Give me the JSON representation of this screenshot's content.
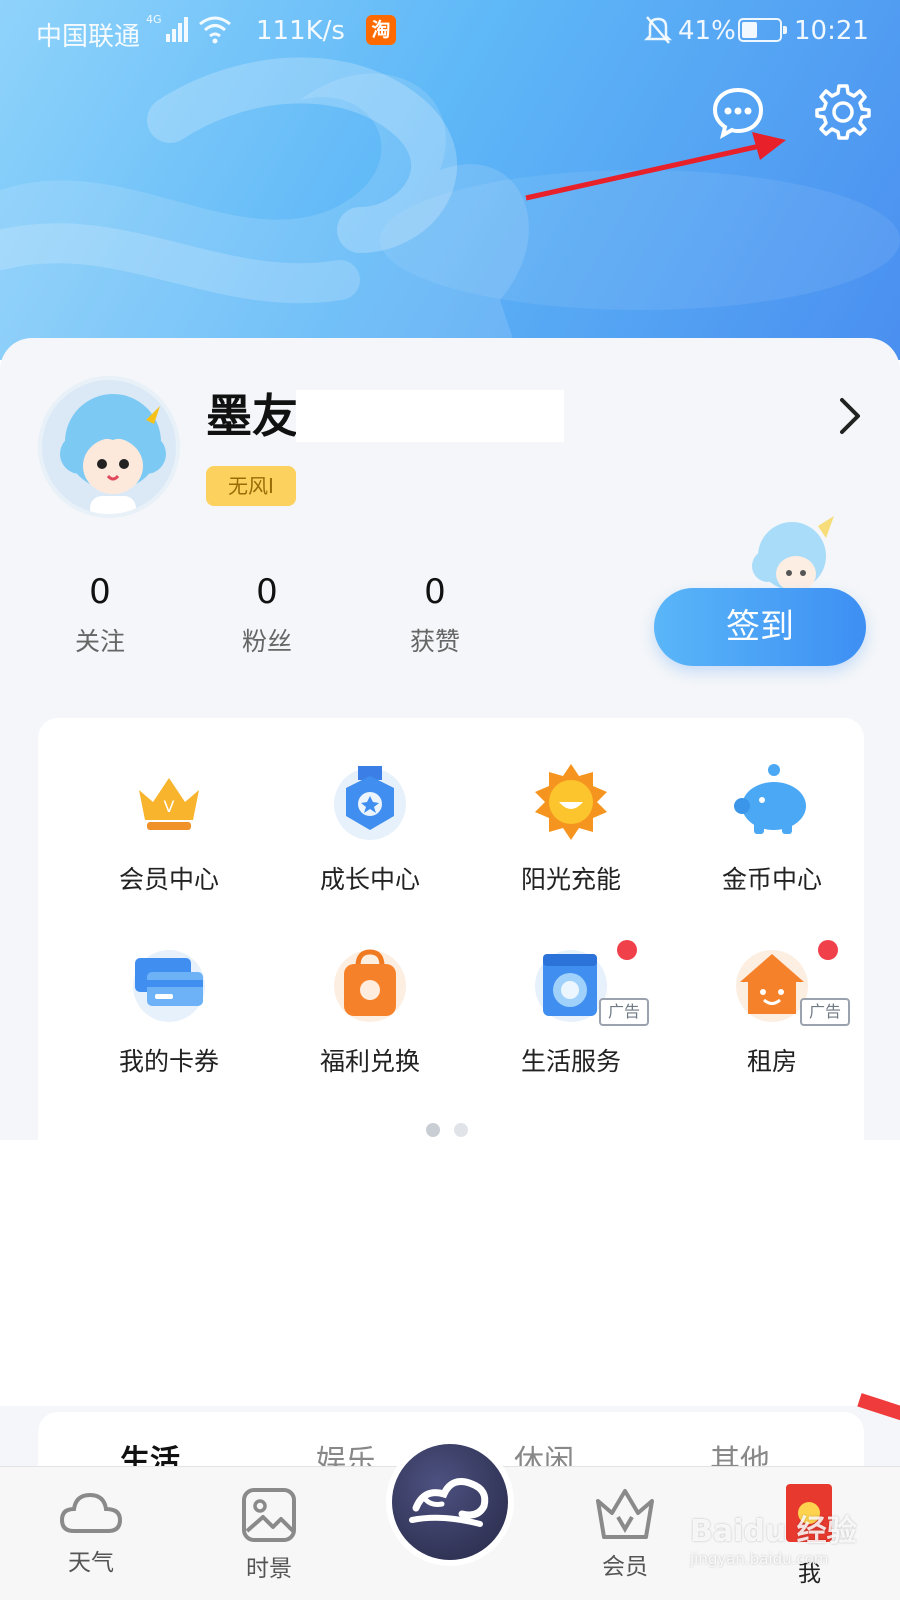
{
  "status_bar": {
    "carrier": "中国联通",
    "network": "4G",
    "speed": "111K/s",
    "taobao_icon": "淘",
    "battery": "41%",
    "battery_level": 0.41,
    "time": "10:21"
  },
  "header": {
    "icons": [
      "message-icon",
      "settings-gear-icon"
    ]
  },
  "profile": {
    "username": "墨友",
    "badge": "无风I",
    "stats": [
      {
        "value": "0",
        "label": "关注"
      },
      {
        "value": "0",
        "label": "粉丝"
      },
      {
        "value": "0",
        "label": "获赞"
      }
    ],
    "checkin_label": "签到"
  },
  "services": {
    "items": [
      {
        "label": "会员中心",
        "icon": "crown-icon"
      },
      {
        "label": "成长中心",
        "icon": "medal-icon"
      },
      {
        "label": "阳光充能",
        "icon": "sun-icon"
      },
      {
        "label": "金币中心",
        "icon": "piggy-bank-icon"
      },
      {
        "label": "我的卡券",
        "icon": "card-icon"
      },
      {
        "label": "福利兑换",
        "icon": "shopping-bag-icon"
      },
      {
        "label": "生活服务",
        "icon": "washing-machine-icon",
        "ad": "广告"
      },
      {
        "label": "租房",
        "icon": "house-icon",
        "ad": "广告"
      }
    ],
    "pages": 2,
    "current_page": 1
  },
  "category_tabs": [
    "生活",
    "娱乐",
    "休闲",
    "其他"
  ],
  "bottom_nav": {
    "items": [
      {
        "label": "天气",
        "icon": "cloud-icon"
      },
      {
        "label": "时景",
        "icon": "picture-icon"
      },
      {
        "label": "",
        "icon": "cloud-logo-icon"
      },
      {
        "label": "会员",
        "icon": "crown-v-icon"
      },
      {
        "label": "我",
        "icon": "red-envelope-icon"
      }
    ]
  },
  "watermark": {
    "brand": "Baidu 经验",
    "url": "jingyan.baidu.com"
  },
  "colors": {
    "accent": "#3d8ff3",
    "header_gradient_start": "#8fd3fb",
    "header_gradient_end": "#4a8ff0",
    "badge": "#fcd15d",
    "alert_dot": "#f0404a",
    "annotation_arrow": "#e8202a"
  }
}
